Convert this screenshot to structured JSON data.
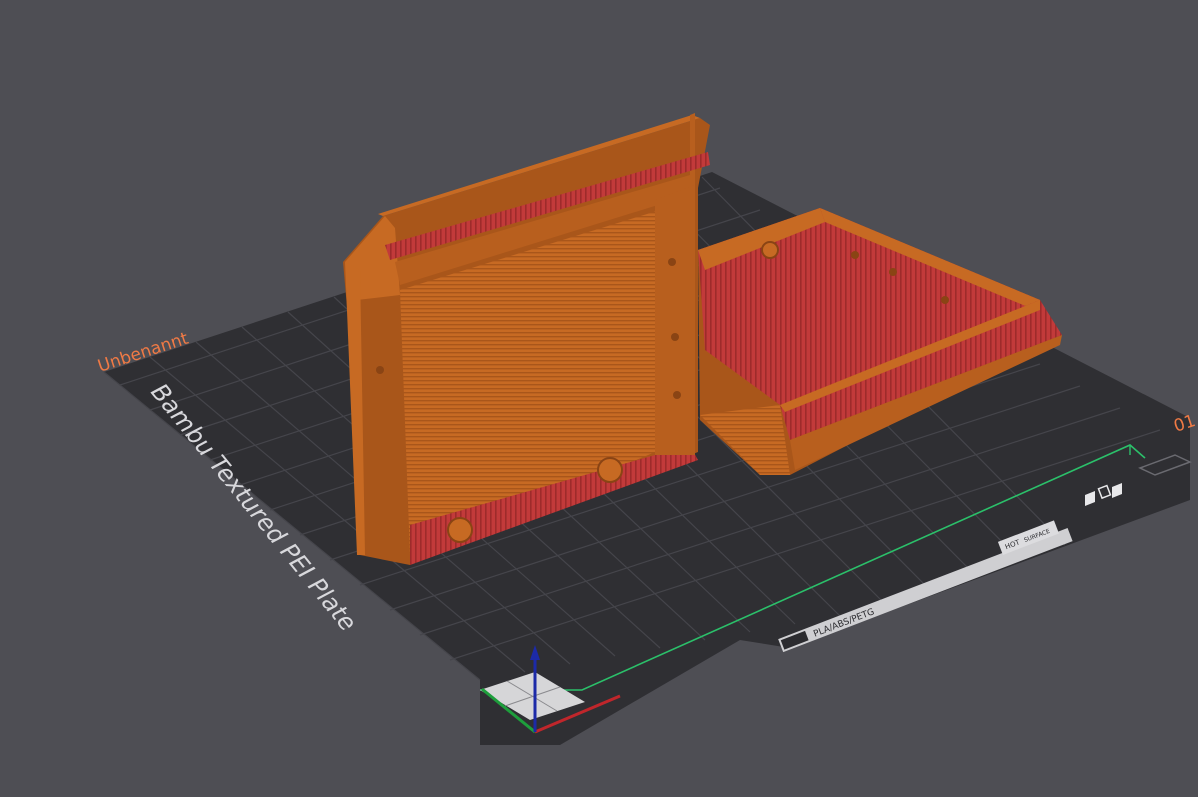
{
  "plate": {
    "name": "Unbenannt",
    "model_label": "Bambu Textured PEI Plate",
    "plate_number": "01",
    "filament_label": "PLA/ABS/PETG",
    "hot_label": "HOT",
    "hot_sub_label": "SURFACE"
  },
  "colors": {
    "background": "#4e4e54",
    "plate_surface": "#2f2f33",
    "plate_grid": "#4c4c52",
    "plate_name": "#f07a45",
    "plate_label": "#d8d8dc",
    "model_orange": "#c76a23",
    "model_orange_dark": "#a9561a",
    "model_red": "#c23a3a",
    "axis_x": "#c0262b",
    "axis_y": "#1e9e3c",
    "axis_z": "#1c2aa8",
    "build_outline": "#2bc06a"
  }
}
